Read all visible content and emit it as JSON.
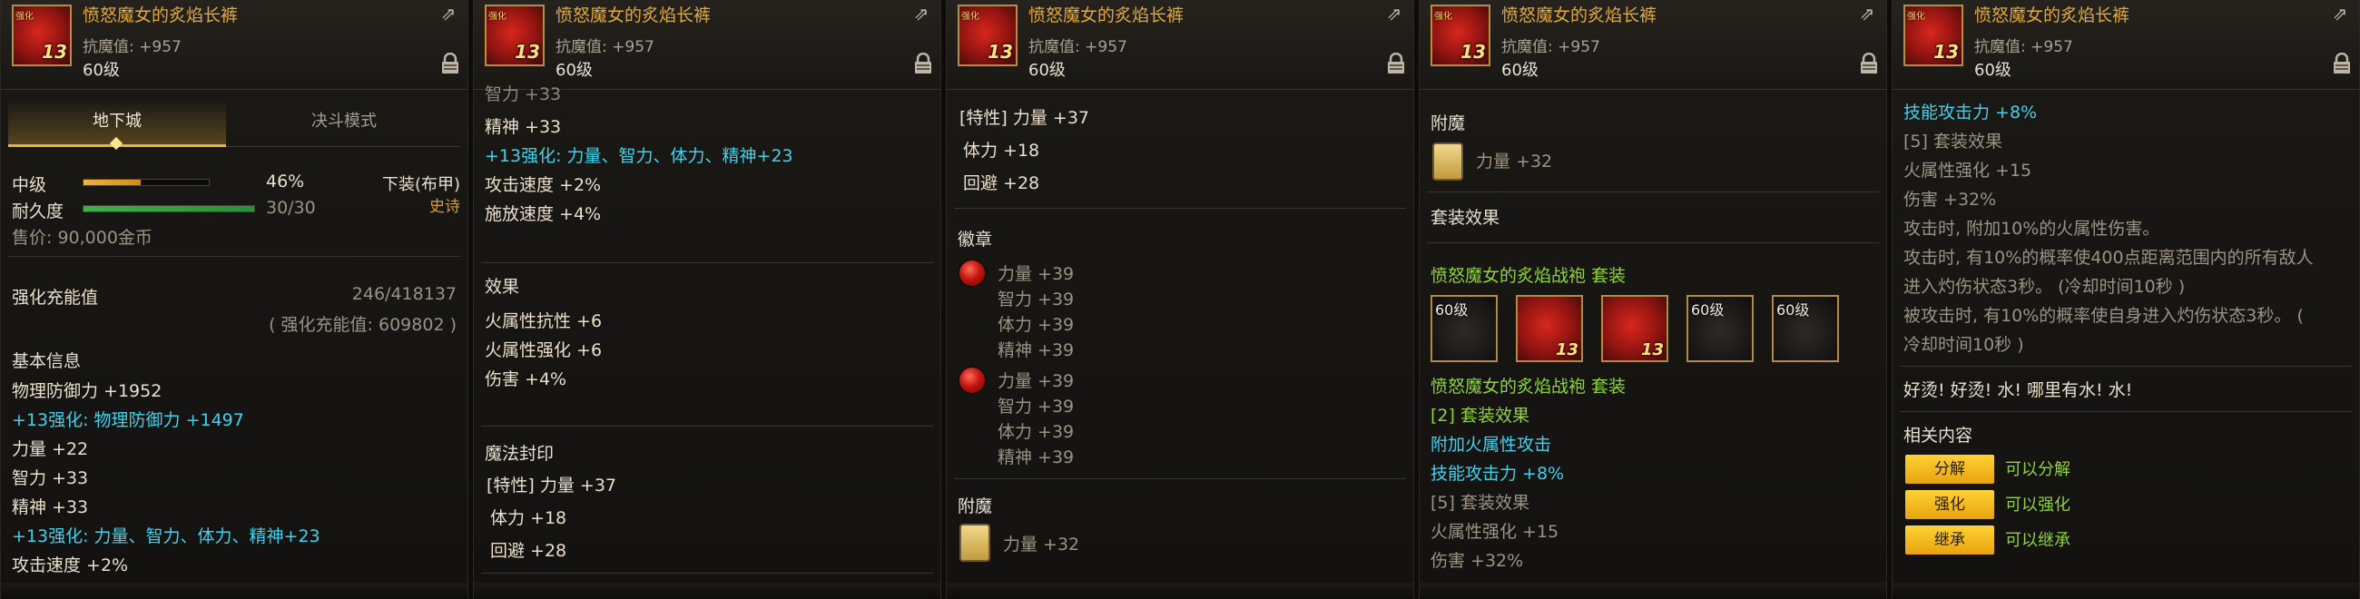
{
  "item": {
    "name": "愤怒魔女的炙焰长裤",
    "type_line": "抗魔值: +957",
    "level": "60级",
    "icon_level": "13",
    "icon_tag": "强化"
  },
  "p1": {
    "tabs": [
      "地下城",
      "决斗模式"
    ],
    "grade": "中级",
    "grade_pct": "46%",
    "grade_fill": 0.46,
    "durability_label": "耐久度",
    "durability": "30/30",
    "durability_fill": 1.0,
    "slot": "下装(布甲)",
    "rarity": "史诗",
    "price": "售价: 90,000金币",
    "charge_label": "强化充能值",
    "charge_value": "246/418137",
    "charge_total": "( 强化充能值: 609802 )",
    "basic_header": "基本信息",
    "stats": [
      {
        "text": "物理防御力 +1952",
        "style": "ye"
      },
      {
        "text": "+13强化: 物理防御力 +1497",
        "style": "cy"
      },
      {
        "text": "力量 +22",
        "style": "ye"
      },
      {
        "text": "智力 +33",
        "style": "ye"
      },
      {
        "text": "精神 +33",
        "style": "ye"
      },
      {
        "text": "+13强化: 力量、智力、体力、精神+23",
        "style": "cy"
      },
      {
        "text": "攻击速度 +2%",
        "style": "ye"
      }
    ]
  },
  "p2": {
    "top_lines": [
      {
        "text": "智力 +33",
        "style": "ye"
      },
      {
        "text": "精神 +33",
        "style": "ye"
      },
      {
        "text": "+13强化: 力量、智力、体力、精神+23",
        "style": "cy"
      },
      {
        "text": "攻击速度 +2%",
        "style": "ye"
      },
      {
        "text": "施放速度 +4%",
        "style": "ye"
      }
    ],
    "effect_header": "效果",
    "effects": [
      "火属性抗性 +6",
      "火属性强化 +6",
      "伤害 +4%"
    ],
    "seal_header": "魔法封印",
    "seals": [
      "[特性] 力量 +37",
      "体力 +18",
      "回避 +28"
    ]
  },
  "p3": {
    "seals": [
      "[特性] 力量 +37",
      "体力 +18",
      "回避 +28"
    ],
    "emblem_header": "徽章",
    "emblem1": [
      "力量 +39",
      "智力 +39",
      "体力 +39",
      "精神 +39"
    ],
    "emblem2": [
      "力量 +39",
      "智力 +39",
      "体力 +39",
      "精神 +39"
    ],
    "enchant_header": "附魔",
    "enchant": "力量 +32"
  },
  "p4": {
    "enchant_header": "附魔",
    "enchant": "力量 +32",
    "set_header": "套装效果",
    "set_name": "愤怒魔女的炙焰战袍 套装",
    "slots": [
      "60级",
      "",
      "",
      "60级",
      "60级"
    ],
    "set_name2": "愤怒魔女的炙焰战袍 套装",
    "set2_label": "[2] 套装效果",
    "set2_lines": [
      "附加火属性攻击",
      "技能攻击力 +8%"
    ],
    "set5_label": "[5] 套装效果",
    "set5_lines": [
      "火属性强化 +15",
      "伤害 +32%"
    ]
  },
  "p5": {
    "top": "技能攻击力 +8%",
    "set5_label": "[5] 套装效果",
    "lines": [
      "火属性强化 +15",
      "伤害 +32%",
      "攻击时, 附加10%的火属性伤害。",
      "攻击时, 有10%的概率使400点距离范围内的所有敌人",
      "进入灼伤状态3秒。 (冷却时间10秒 )",
      "被攻击时, 有10%的概率使自身进入灼伤状态3秒。 (",
      "冷却时间10秒 )"
    ],
    "flavor": "好烫! 好烫! 水! 哪里有水! 水!",
    "related_header": "相关内容",
    "actions": [
      {
        "button": "分解",
        "text": "可以分解"
      },
      {
        "button": "强化",
        "text": "可以强化"
      },
      {
        "button": "继承",
        "text": "可以继承"
      }
    ]
  },
  "colors": {
    "gold": "#e2a93a",
    "cyan": "#3fd2ec",
    "green": "#8fd43a",
    "button": "#ffc424"
  }
}
